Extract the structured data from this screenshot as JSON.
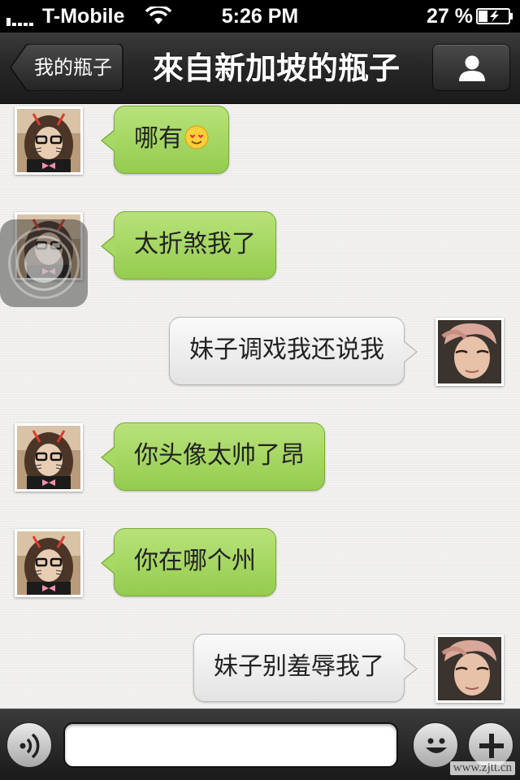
{
  "status_bar": {
    "carrier": "T-Mobile",
    "time": "5:26 PM",
    "battery_percent": "27 %",
    "signal_bars": 1
  },
  "nav": {
    "back_label": "我的瓶子",
    "title": "來自新加坡的瓶子",
    "profile_icon": "person-icon"
  },
  "messages": [
    {
      "side": "in",
      "text": "哪有",
      "emoji": "heart-eyes-emoji"
    },
    {
      "side": "in",
      "text": "太折煞我了"
    },
    {
      "side": "out",
      "text": "妹子调戏我还说我"
    },
    {
      "side": "in",
      "text": "你头像太帅了昂"
    },
    {
      "side": "in",
      "text": "你在哪个州"
    },
    {
      "side": "out",
      "text": "妹子别羞辱我了"
    }
  ],
  "input_bar": {
    "text_value": "",
    "voice_icon": "voice-icon",
    "emoji_icon": "smiley-icon",
    "more_icon": "plus-icon"
  },
  "watermark": "www.zjtt.cn",
  "colors": {
    "incoming_bubble": "#a7d966",
    "outgoing_bubble": "#ededed",
    "nav_background": "#262626"
  }
}
